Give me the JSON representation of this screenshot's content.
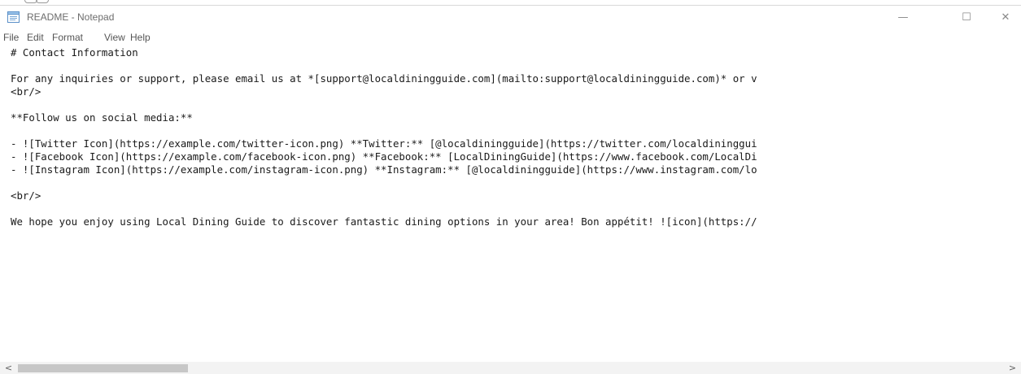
{
  "window": {
    "title": "README - Notepad",
    "controls": {
      "minimize": "—",
      "maximize": "☐",
      "close": "✕"
    }
  },
  "menu": {
    "items": [
      "File",
      "Edit",
      "Format",
      "View",
      "Help"
    ]
  },
  "editor": {
    "lines": [
      "# Contact Information",
      "",
      "For any inquiries or support, please email us at *[support@localdiningguide.com](mailto:support@localdiningguide.com)* or v",
      "<br/>",
      "",
      "**Follow us on social media:**",
      "",
      "- ![Twitter Icon](https://example.com/twitter-icon.png) **Twitter:** [@localdiningguide](https://twitter.com/localdininggui",
      "- ![Facebook Icon](https://example.com/facebook-icon.png) **Facebook:** [LocalDiningGuide](https://www.facebook.com/LocalDi",
      "- ![Instagram Icon](https://example.com/instagram-icon.png) **Instagram:** [@localdiningguide](https://www.instagram.com/lo",
      "",
      "<br/>",
      "",
      "We hope you enjoy using Local Dining Guide to discover fantastic dining options in your area! Bon appétit! ![icon](https://"
    ]
  },
  "scrollbar": {
    "left_arrow": "<",
    "right_arrow": ">"
  },
  "icons": {
    "app": "notepad-icon",
    "minimize": "minimize-icon",
    "maximize": "maximize-icon",
    "close": "close-icon"
  }
}
